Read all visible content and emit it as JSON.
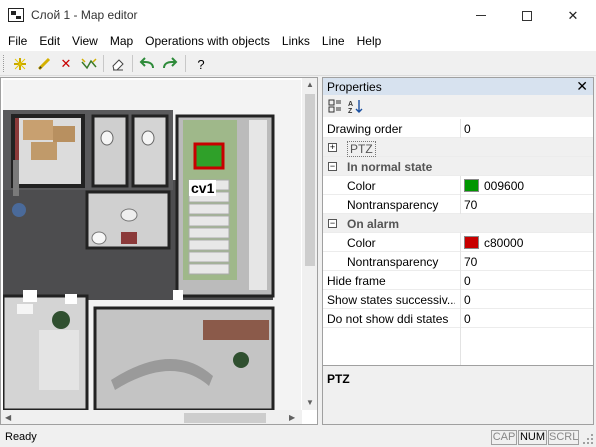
{
  "window": {
    "title": "Слой 1 - Map editor"
  },
  "menu": [
    "File",
    "Edit",
    "View",
    "Map",
    "Operations with objects",
    "Links",
    "Line",
    "Help"
  ],
  "toolbar": {
    "help_label": "?"
  },
  "map": {
    "camera_label": "cv1"
  },
  "properties": {
    "title": "Properties",
    "close_label": "✕",
    "rows": [
      {
        "name": "Drawing order",
        "value": "0"
      },
      {
        "name": "PTZ",
        "value": ""
      },
      {
        "name": "In normal state",
        "value": ""
      },
      {
        "name": "Color",
        "value": "009600",
        "color": "#009600"
      },
      {
        "name": "Nontransparency",
        "value": "70"
      },
      {
        "name": "On alarm",
        "value": ""
      },
      {
        "name": "Color",
        "value": "c80000",
        "color": "#c80000"
      },
      {
        "name": "Nontransparency",
        "value": "70"
      },
      {
        "name": "Hide frame",
        "value": "0"
      },
      {
        "name": "Show states successiv...",
        "value": "0"
      },
      {
        "name": "Do not show ddi states",
        "value": "0"
      }
    ],
    "description_title": "PTZ"
  },
  "status": {
    "text": "Ready",
    "cap": "CAP",
    "num": "NUM",
    "scrl": "SCRL"
  },
  "colors": {
    "header_bg": "#d7e2ef",
    "normal_color": "#009600",
    "alarm_color": "#c80000"
  }
}
